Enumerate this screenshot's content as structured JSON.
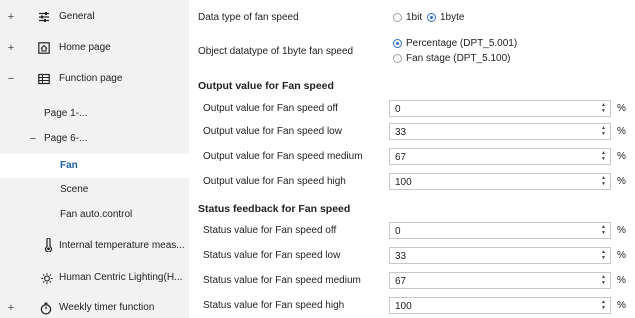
{
  "sidebar": {
    "items": [
      {
        "expander": "+",
        "label": "General"
      },
      {
        "expander": "+",
        "label": "Home page"
      },
      {
        "expander": "−",
        "label": "Function page"
      },
      {
        "label": "Page 1-..."
      },
      {
        "expander": "−",
        "label": "Page 6-..."
      },
      {
        "label": "Fan"
      },
      {
        "label": "Scene"
      },
      {
        "label": "Fan auto.control"
      },
      {
        "label": "Internal temperature meas..."
      },
      {
        "label": "Human Centric Lighting(H..."
      },
      {
        "expander": "+",
        "label": "Weekly timer function"
      }
    ]
  },
  "settings": {
    "data_type": {
      "label": "Data type of fan speed",
      "options": [
        "1bit",
        "1byte"
      ],
      "selected": "1byte"
    },
    "object_datatype": {
      "label": "Object datatype of 1byte fan speed",
      "options": [
        "Percentage (DPT_5.001)",
        "Fan stage (DPT_5.100)"
      ],
      "selected": "Percentage (DPT_5.001)"
    },
    "output_section": "Output value for Fan speed",
    "output_rows": [
      {
        "label": "Output value for Fan speed off",
        "value": "0",
        "unit": "%"
      },
      {
        "label": "Output value for Fan speed low",
        "value": "33",
        "unit": "%"
      },
      {
        "label": "Output value for Fan speed medium",
        "value": "67",
        "unit": "%"
      },
      {
        "label": "Output value for Fan speed high",
        "value": "100",
        "unit": "%"
      }
    ],
    "status_section": "Status feedback for Fan speed",
    "status_rows": [
      {
        "label": "Status value for Fan speed off",
        "value": "0",
        "unit": "%"
      },
      {
        "label": "Status value for Fan speed low",
        "value": "33",
        "unit": "%"
      },
      {
        "label": "Status value for Fan speed medium",
        "value": "67",
        "unit": "%"
      },
      {
        "label": "Status value for Fan speed high",
        "value": "100",
        "unit": "%"
      }
    ]
  },
  "icons": {
    "general": "sliders-icon",
    "home": "house-icon",
    "function": "grid-icon",
    "temperature": "thermometer-icon",
    "hcl": "sun-icon",
    "timer": "stopwatch-icon"
  },
  "colors": {
    "sidebar_bg": "#f2f2f2",
    "active_text": "#1f5fb0",
    "radio_selected": "#2a6dc8"
  }
}
